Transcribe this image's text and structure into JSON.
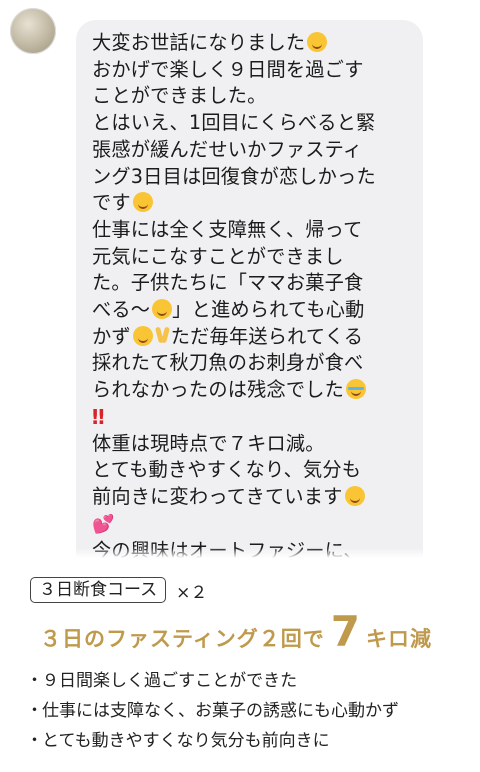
{
  "message": {
    "lines": [
      "大変お世話になりました",
      "おかげで楽しく９日間を過ごす",
      "ことができました。",
      "とはいえ、1回目にくらべると緊",
      "張感が緩んだせいかファスティ",
      "ング3日目は回復食が恋しかった",
      "です",
      "仕事には全く支障無く、帰って",
      "元気にこなすことができまし",
      "た。子供たちに「ママお菓子食",
      "べる〜",
      "」と進められても心動",
      "かず",
      "ただ毎年送られてくる",
      "採れたて秋刀魚のお刺身が食べ",
      "られなかったのは残念でした",
      "‼",
      "体重は現時点で７キロ減。",
      "とても動きやすくなり、気分も",
      "前向きに変わってきています",
      "💕",
      "今の興味はオートファジーに、"
    ]
  },
  "course": {
    "label": "３日断食コース",
    "times": "×２"
  },
  "headline": {
    "pre": "３日のファスティング２回で",
    "num": "7",
    "post": "キロ減"
  },
  "points": [
    "９日間楽しく過ごすことができた",
    "仕事には支障なく、お菓子の誘惑にも心動かず",
    "とても動きやすくなり気分も前向きに"
  ],
  "bullet": "・",
  "colors": {
    "accent": "#c09a4c",
    "bubble": "#f0f0f2"
  },
  "icons": [
    "smiling-face-icon",
    "laughing-tears-icon",
    "grinning-face-icon",
    "victory-hand-icon",
    "crying-face-icon",
    "double-exclamation-icon",
    "two-hearts-icon"
  ]
}
